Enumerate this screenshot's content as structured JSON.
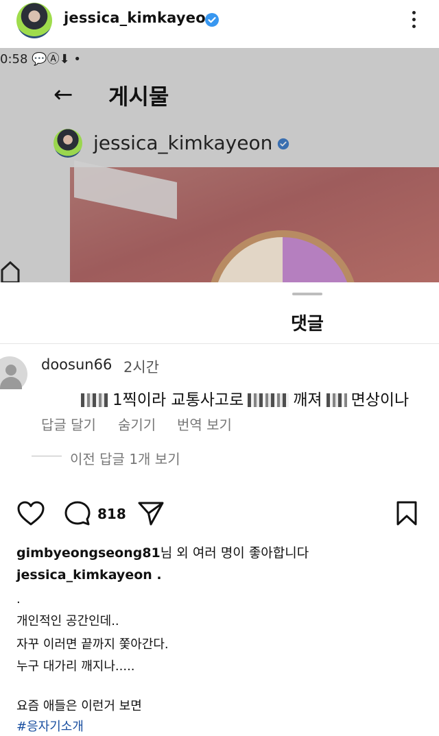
{
  "header": {
    "username": "jessica_kimkayeon",
    "verified_color": "#3897f0"
  },
  "embedded_screenshot": {
    "status_time": "0:58",
    "status_icons": "💬Ⓐ⬇ •",
    "back_icon": "arrow-left-icon",
    "title": "게시물",
    "username": "jessica_kimkayeon"
  },
  "comments_sheet": {
    "title": "댓글",
    "comment": {
      "username": "doosun66",
      "time": "2시간",
      "text_1": "1찍이라 교통사고로",
      "text_2": "깨져",
      "text_3": "면상이나",
      "reply": "답글 달기",
      "hide": "숨기기",
      "translate": "번역 보기",
      "view_previous": "이전 답글 1개 보기"
    }
  },
  "actions": {
    "comment_count": "818"
  },
  "caption": {
    "liked_by_user": "gimbyeongseong81",
    "liked_by_suffix": "님 외 여러 명이 좋아합니다",
    "author": "jessica_kimkayeon .",
    "lines": [
      ".",
      "개인적인 공간인데..",
      "자꾸 이러면 끝까지 쫓아간다.",
      "누구 대가리 깨지나.....",
      "",
      "요즘 애들은 이런거 보면"
    ],
    "hashtag": "#응자기소개"
  }
}
